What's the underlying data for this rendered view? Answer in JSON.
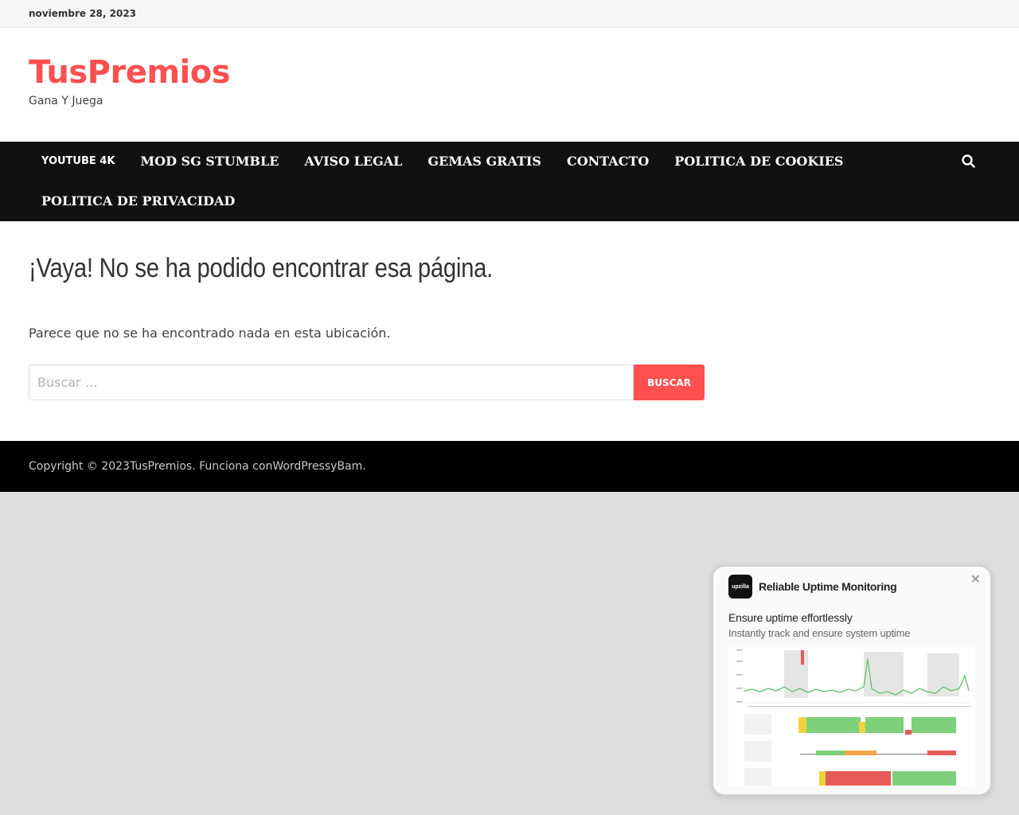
{
  "topbar": {
    "date": "noviembre 28, 2023"
  },
  "site": {
    "title": "TusPremios",
    "description": "Gana Y Juega"
  },
  "nav": {
    "items": [
      "YOUTUBE 4K",
      "MOD SG STUMBLE",
      "AVISO LEGAL",
      "GEMAS GRATIS",
      "CONTACTO",
      "POLITICA DE COOKIES",
      "POLITICA DE PRIVACIDAD"
    ],
    "search_icon": "search-icon"
  },
  "main": {
    "heading": "¡Vaya! No se ha podido encontrar esa página.",
    "message": "Parece que no se ha encontrado nada en esta ubicación.",
    "search_placeholder": "Buscar …",
    "search_button": "BUSCAR"
  },
  "footer": {
    "prefix": "Copyright © 2023 ",
    "site_link": "TusPremios",
    "middle": ". Funciona con ",
    "wp_link": "WordPress",
    "y": " y ",
    "bam_link": "Bam",
    "suffix": "."
  },
  "popup": {
    "logo_text": "upzilla",
    "title": "Reliable Uptime Monitoring",
    "headline": "Ensure uptime effortlessly",
    "subline": "Instantly track and ensure system uptime",
    "close_icon": "close-icon"
  },
  "colors": {
    "accent": "#ff4f4f",
    "nav_bg": "#111111",
    "footer_bg": "#000000"
  }
}
